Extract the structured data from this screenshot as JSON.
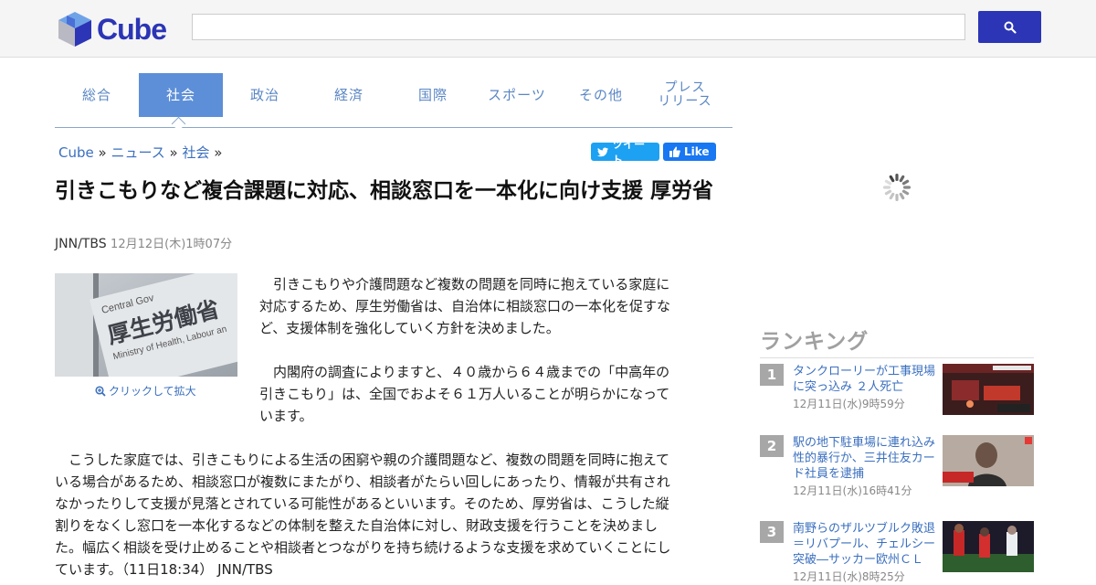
{
  "header": {
    "logo_text": "Cube",
    "search_placeholder": ""
  },
  "tabs": [
    {
      "label": "総合",
      "active": false
    },
    {
      "label": "社会",
      "active": true
    },
    {
      "label": "政治",
      "active": false
    },
    {
      "label": "経済",
      "active": false
    },
    {
      "label": "国際",
      "active": false
    },
    {
      "label": "スポーツ",
      "active": false
    },
    {
      "label": "その他",
      "active": false
    },
    {
      "label_line1": "プレス",
      "label_line2": "リリース",
      "active": false
    }
  ],
  "breadcrumb": {
    "items": [
      "Cube",
      "ニュース",
      "社会"
    ],
    "separator": "»"
  },
  "social": {
    "tweet_label": "ツイート",
    "like_label": "Like"
  },
  "article": {
    "title": "引きこもりなど複合課題に対応、相談窓口を一本化に向け支援 厚労省",
    "source": "JNN/TBS",
    "date": "12月12日(木)1時07分",
    "photo_zoom_label": "クリックして拡大",
    "paragraphs": [
      "　引きこもりや介護問題など複数の問題を同時に抱えている家庭に対応するため、厚生労働省は、自治体に相談窓口の一本化を促すなど、支援体制を強化していく方針を決めました。",
      "　内閣府の調査によりますと、４０歳から６４歳までの「中高年の引きこもり」は、全国でおよそ６１万人いることが明らかになっています。",
      "　こうした家庭では、引きこもりによる生活の困窮や親の介護問題など、複数の問題を同時に抱えている場合があるため、相談窓口が複数にまたがり、相談者がたらい回しにあったり、情報が共有されなかったりして支援が見落とされている可能性があるといいます。そのため、厚労省は、こうした縦割りをなくし窓口を一本化するなどの体制を整えた自治体に対し、財政支援を行うことを決めました。幅広く相談を受け止めることや相談者とつながりを持ち続けるような支援を求めていくことにしています。（11日18:34） JNN/TBS"
    ],
    "photo_sign_lines": [
      "Central Gov",
      "厚生労働省",
      "Ministry of Health, Labour an"
    ]
  },
  "ranking": {
    "title": "ランキング",
    "items": [
      {
        "rank": "1",
        "headline": "タンクローリーが工事現場に突っ込み ２人死亡",
        "date": "12月11日(水)9時59分"
      },
      {
        "rank": "2",
        "headline": "駅の地下駐車場に連れ込み性的暴行か、三井住友カード社員を逮捕",
        "date": "12月11日(水)16時41分"
      },
      {
        "rank": "3",
        "headline": "南野らのザルツブルク敗退＝リバプール、チェルシー突破―サッカー欧州ＣＬ",
        "date": "12月11日(水)8時25分"
      }
    ]
  },
  "colors": {
    "brand": "#2b35b5",
    "tab_active": "#5d8fd8",
    "link": "#3a6fbf"
  }
}
